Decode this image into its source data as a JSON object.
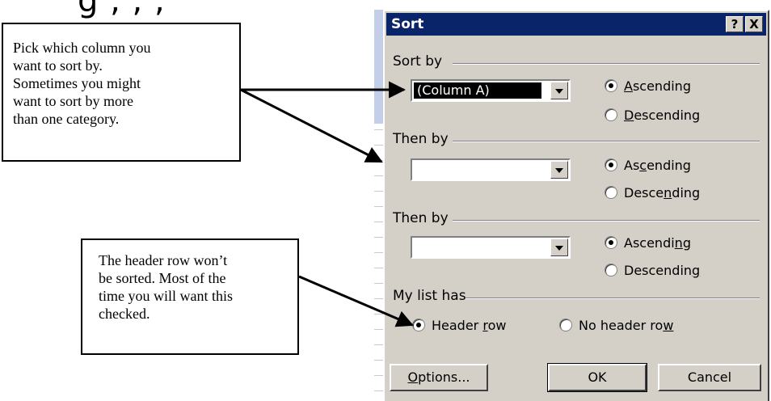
{
  "page_fragment_text": "g , , ,",
  "dialog": {
    "title": "Sort",
    "help_button": "?",
    "close_button": "X",
    "sort_by": {
      "label": "Sort by",
      "combo_value": "(Column A)",
      "ascending": {
        "label": "Ascending",
        "mnemonic": 0,
        "checked": true
      },
      "descending": {
        "label": "Descending",
        "mnemonic": 0,
        "checked": false
      }
    },
    "then_by_1": {
      "label": "Then by",
      "combo_value": "",
      "ascending": {
        "label": "Ascending",
        "mnemonic": 2,
        "checked": true
      },
      "descending": {
        "label": "Descending",
        "mnemonic": 5,
        "checked": false
      }
    },
    "then_by_2": {
      "label": "Then by",
      "combo_value": "",
      "ascending": {
        "label": "Ascending",
        "mnemonic": 7,
        "checked": true
      },
      "descending": {
        "label": "Descending",
        "mnemonic": 9,
        "checked": false
      }
    },
    "my_list_has": {
      "label": "My list has",
      "header_row": {
        "label": "Header row",
        "mnemonic": 7,
        "checked": true
      },
      "no_header_row": {
        "label": "No header row",
        "mnemonic": 12,
        "checked": false
      }
    },
    "buttons": {
      "options": {
        "label": "Options...",
        "mnemonic": 0
      },
      "ok": "OK",
      "cancel": "Cancel"
    }
  },
  "callouts": {
    "sort_column": [
      "Pick which column you",
      "want to sort by.",
      "Sometimes you might",
      "want to sort by  more",
      "than one category."
    ],
    "header_row": [
      "The header row won’t",
      "be sorted. Most of the",
      "time you will want this",
      "checked."
    ]
  },
  "colors": {
    "dialog_face": "#d4d0c8",
    "titlebar": "#0a246a",
    "sheet_highlight": "#c3cfe8"
  }
}
